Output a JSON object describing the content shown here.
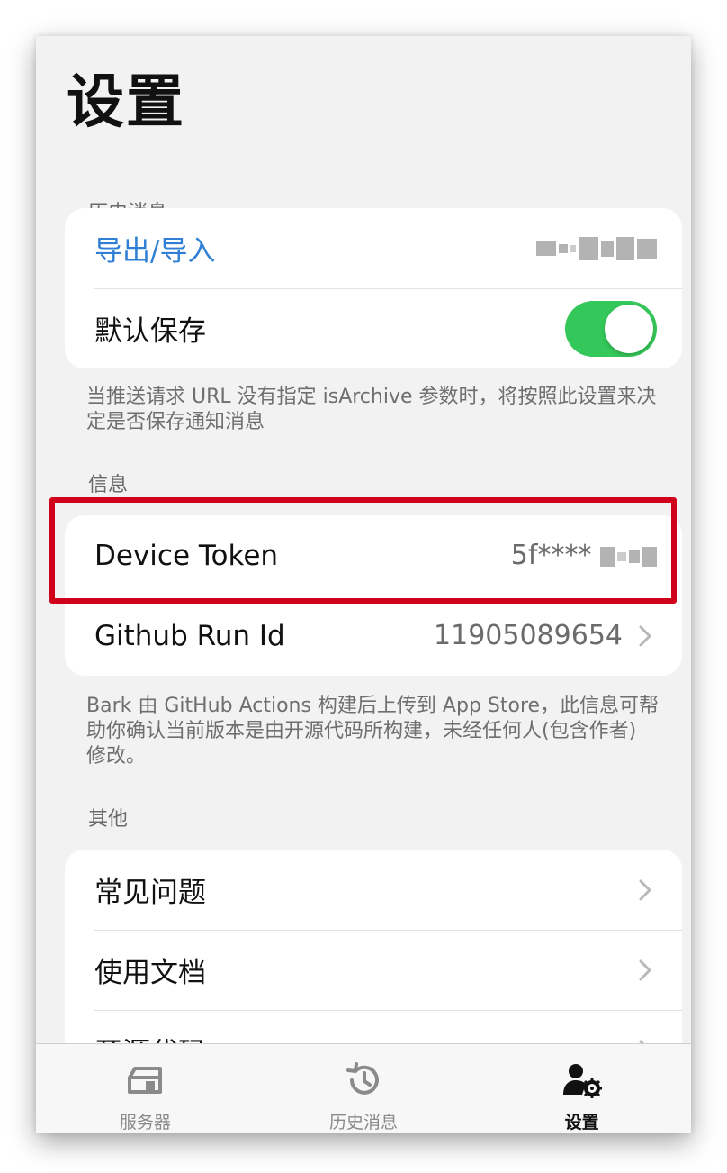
{
  "page": {
    "title": "设置"
  },
  "sections": {
    "history": {
      "header": "历史消息",
      "export_label": "导出/导入",
      "default_save_label": "默认保存",
      "default_save_on": true,
      "footer": "当推送请求 URL 没有指定 isArchive 参数时，将按照此设置来决定是否保存通知消息"
    },
    "info": {
      "header": "信息",
      "device_token_label": "Device Token",
      "device_token_value": "5f****",
      "github_run_label": "Github Run Id",
      "github_run_value": "11905089654",
      "footer": "Bark 由 GitHub Actions 构建后上传到 App Store，此信息可帮助你确认当前版本是由开源代码所构建，未经任何人(包含作者) 修改。"
    },
    "other": {
      "header": "其他",
      "faq_label": "常见问题",
      "docs_label": "使用文档",
      "source_label": "开源代码"
    }
  },
  "tabbar": {
    "tabs": [
      {
        "label": "服务器",
        "icon": "server-icon",
        "active": false
      },
      {
        "label": "历史消息",
        "icon": "history-icon",
        "active": false
      },
      {
        "label": "设置",
        "icon": "settings-user-icon",
        "active": true
      }
    ]
  },
  "colors": {
    "accent": "#2f7fd6",
    "toggle_on": "#34c759",
    "highlight": "#d0021b",
    "background": "#f2f2f2"
  }
}
